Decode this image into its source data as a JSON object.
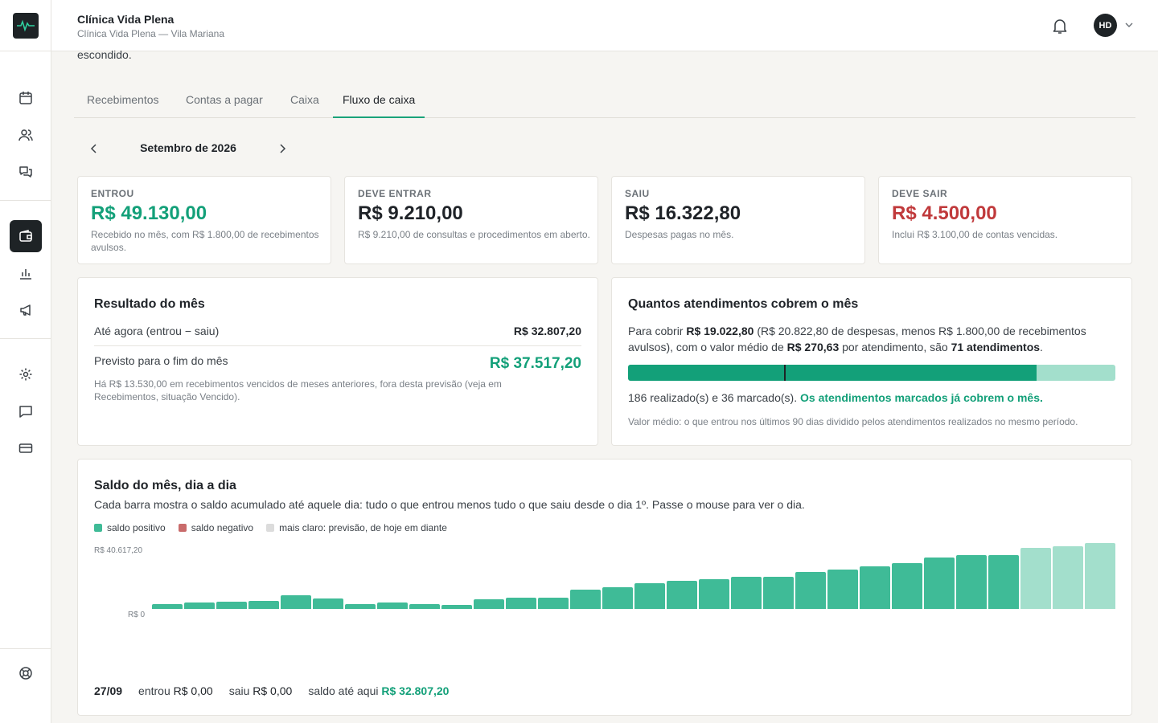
{
  "header": {
    "clinic_name": "Clínica Vida Plena",
    "clinic_sub": "Clínica Vida Plena — Vila Mariana",
    "avatar_initials": "HD"
  },
  "sidebar": {
    "items": [
      {
        "icon": "calendar-icon"
      },
      {
        "icon": "users-icon"
      },
      {
        "icon": "chat-icon"
      },
      {
        "icon": "wallet-icon",
        "active": true
      },
      {
        "icon": "bar-chart-icon"
      },
      {
        "icon": "megaphone-icon"
      },
      {
        "icon": "gear-icon"
      },
      {
        "icon": "message-icon"
      },
      {
        "icon": "credit-card-icon"
      },
      {
        "icon": "help-icon"
      }
    ]
  },
  "cut_text": "escondido.",
  "tabs": [
    {
      "label": "Recebimentos"
    },
    {
      "label": "Contas a pagar"
    },
    {
      "label": "Caixa"
    },
    {
      "label": "Fluxo de caixa",
      "active": true
    }
  ],
  "month": {
    "label": "Setembro de 2026"
  },
  "kpis": [
    {
      "label": "ENTROU",
      "value": "R$ 49.130,00",
      "note": "Recebido no mês, com R$ 1.800,00 de recebimentos avulsos.",
      "color": "#13a079"
    },
    {
      "label": "DEVE ENTRAR",
      "value": "R$ 9.210,00",
      "note": "R$ 9.210,00 de consultas e procedimentos em aberto.",
      "color": "#1f2328"
    },
    {
      "label": "SAIU",
      "value": "R$ 16.322,80",
      "note": "Despesas pagas no mês.",
      "color": "#1f2328"
    },
    {
      "label": "DEVE SAIR",
      "value": "R$ 4.500,00",
      "note": "Inclui R$ 3.100,00 de contas vencidas.",
      "color": "#c0393b"
    }
  ],
  "resultado": {
    "title": "Resultado do mês",
    "row1_label": "Até agora (entrou − saiu)",
    "row1_value": "R$ 32.807,20",
    "row2_label": "Previsto para o fim do mês",
    "row2_value": "R$ 37.517,20",
    "footnote": "Há R$ 13.530,00 em recebimentos vencidos de meses anteriores, fora desta previsão (veja em Recebimentos, situação Vencido)."
  },
  "cobertura": {
    "title": "Quantos atendimentos cobrem o mês",
    "t1": "Para cobrir ",
    "b1": "R$ 19.022,80",
    "t2": " (R$ 20.822,80 de despesas, menos R$ 1.800,00 de recebimentos avulsos), com o valor médio de ",
    "b2": "R$ 270,63",
    "t3": " por atendimento, são ",
    "b3": "71 atendimentos",
    "t4": ".",
    "fill_fraction": 0.838,
    "marker_fraction": 0.32,
    "status_text": "186 realizado(s) e 36 marcado(s). ",
    "status_ok": "Os atendimentos marcados já cobrem o mês.",
    "footnote": "Valor médio: o que entrou nos últimos 90 dias dividido pelos atendimentos realizados no mesmo período."
  },
  "saldo": {
    "title": "Saldo do mês, dia a dia",
    "subtitle": "Cada barra mostra o saldo acumulado até aquele dia: tudo o que entrou menos tudo o que saiu desde o dia 1º. Passe o mouse para ver o dia.",
    "legend": [
      {
        "label": "saldo positivo",
        "color": "#3fbb97"
      },
      {
        "label": "saldo negativo",
        "color": "#c96b6b"
      },
      {
        "label": "mais claro: previsão, de hoje em diante",
        "color": "#dcdcdc"
      }
    ],
    "y_top": "R$ 40.617,20",
    "y_zero": "R$ 0",
    "day_label": "27/09",
    "day_in_label": "entrou",
    "day_in": "R$ 0,00",
    "day_out_label": "saiu",
    "day_out": "R$ 0,00",
    "day_balance_label": "saldo até aqui",
    "day_balance": "R$ 32.807,20"
  },
  "chart_data": {
    "type": "bar",
    "title": "Saldo do mês, dia a dia",
    "x": [
      1,
      2,
      3,
      4,
      5,
      6,
      7,
      8,
      9,
      10,
      11,
      12,
      13,
      14,
      15,
      16,
      17,
      18,
      19,
      20,
      21,
      22,
      23,
      24,
      25,
      26,
      27,
      28,
      29,
      30
    ],
    "values": [
      3050,
      4060,
      4570,
      5080,
      8630,
      6600,
      3050,
      4060,
      3050,
      2540,
      6090,
      7110,
      7110,
      11680,
      13210,
      15740,
      17260,
      18280,
      19800,
      19800,
      22850,
      24370,
      26400,
      28430,
      31480,
      33000,
      33000,
      37570,
      38600,
      40617.2
    ],
    "forecast_from_index": 27,
    "ylim": [
      0,
      40617.2
    ],
    "colors": {
      "positive": "#3fbb97",
      "forecast": "#a3dfcc",
      "negative": "#c96b6b"
    }
  }
}
